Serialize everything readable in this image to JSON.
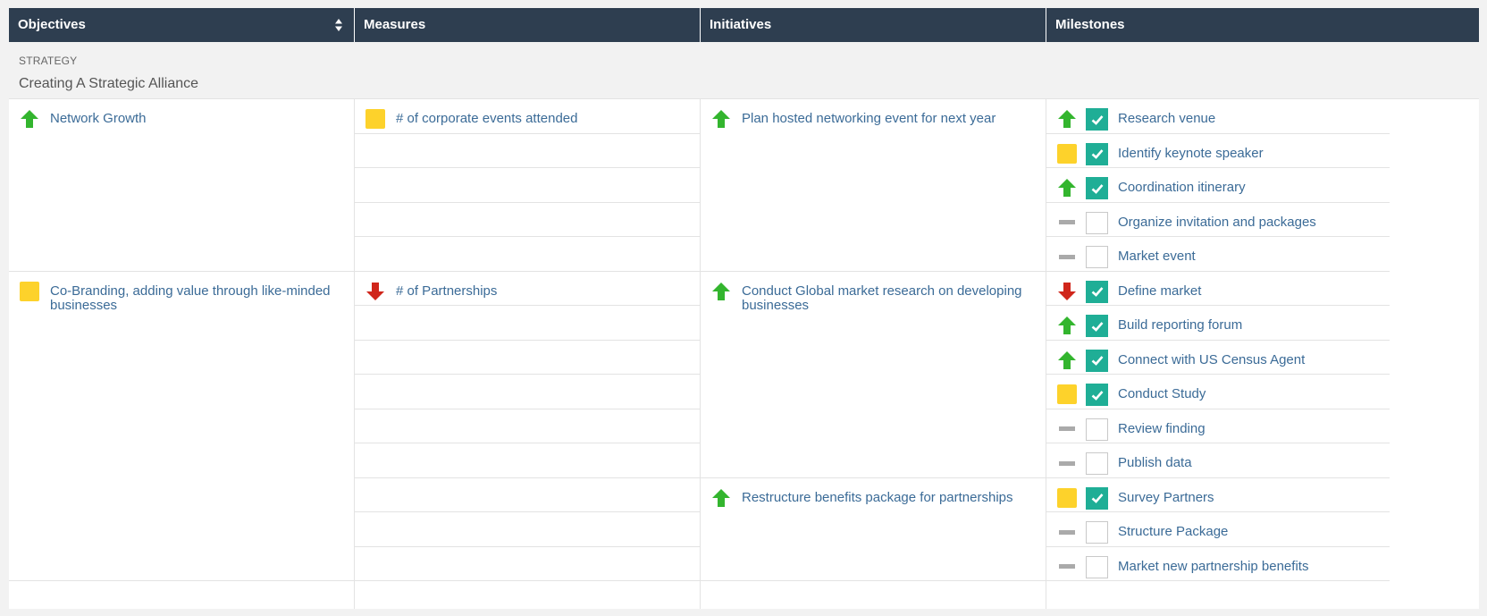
{
  "columns": [
    {
      "label": "Objectives"
    },
    {
      "label": "Measures"
    },
    {
      "label": "Initiatives"
    },
    {
      "label": "Milestones"
    }
  ],
  "strategy": {
    "label": "STRATEGY",
    "name": "Creating A Strategic Alliance"
  },
  "colors": {
    "up": "#33b52e",
    "down": "#d0261b",
    "warn": "#fdd22b",
    "done": "#1fae96",
    "header": "#2e3e50",
    "link": "#3b6b97"
  },
  "objectives": [
    {
      "status": "up-arrow",
      "label": "Network Growth"
    },
    {
      "status": "yellow-square",
      "label": "Co-Branding, adding value through like-minded businesses"
    }
  ],
  "measures": [
    {
      "status": "yellow-square",
      "label": "# of corporate events attended"
    },
    {
      "status": "down-arrow",
      "label": "# of Partnerships"
    }
  ],
  "initiatives": [
    {
      "status": "up-arrow",
      "label": "Plan hosted networking event for next year"
    },
    {
      "status": "up-arrow",
      "label": "Conduct Global market research on developing businesses"
    },
    {
      "status": "up-arrow",
      "label": "Restructure benefits package for partnerships"
    }
  ],
  "milestones": [
    {
      "status": "up-arrow",
      "checked": true,
      "label": "Research venue"
    },
    {
      "status": "yellow-square",
      "checked": true,
      "label": "Identify keynote speaker"
    },
    {
      "status": "up-arrow",
      "checked": true,
      "label": "Coordination itinerary"
    },
    {
      "status": "gray-dash",
      "checked": false,
      "label": "Organize invitation and packages"
    },
    {
      "status": "gray-dash",
      "checked": false,
      "label": "Market event"
    },
    {
      "status": "down-arrow",
      "checked": true,
      "label": "Define market"
    },
    {
      "status": "up-arrow",
      "checked": true,
      "label": "Build reporting forum"
    },
    {
      "status": "up-arrow",
      "checked": true,
      "label": "Connect with US Census Agent"
    },
    {
      "status": "yellow-square",
      "checked": true,
      "label": "Conduct Study"
    },
    {
      "status": "gray-dash",
      "checked": false,
      "label": "Review finding"
    },
    {
      "status": "gray-dash",
      "checked": false,
      "label": "Publish data"
    },
    {
      "status": "yellow-square",
      "checked": true,
      "label": "Survey Partners"
    },
    {
      "status": "gray-dash",
      "checked": false,
      "label": "Structure Package"
    },
    {
      "status": "gray-dash",
      "checked": false,
      "label": "Market new partnership benefits"
    }
  ]
}
